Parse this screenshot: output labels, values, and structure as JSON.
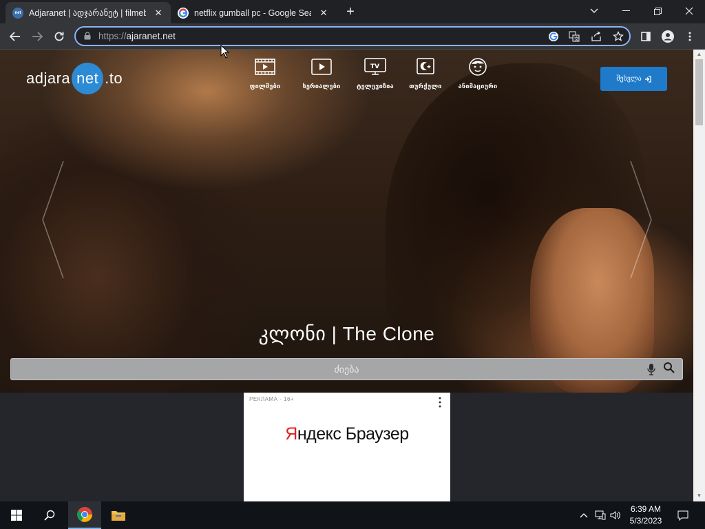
{
  "browser": {
    "tabs": [
      {
        "title": "Adjaranet | ადჯარანეტ | filmebi",
        "favicon": "net",
        "active": true
      },
      {
        "title": "netflix gumball pc - Google Search",
        "favicon": "google",
        "active": false
      }
    ],
    "url_scheme": "https://",
    "url_host": "ajaranet.net"
  },
  "site": {
    "logo": {
      "left": "adjara",
      "circle": "net",
      "right": ".to"
    },
    "menu": [
      {
        "label": "ფილმები",
        "icon": "film-icon"
      },
      {
        "label": "სერიალები",
        "icon": "play-icon"
      },
      {
        "label": "ტელევიზია",
        "icon": "tv-icon"
      },
      {
        "label": "თურქული",
        "icon": "turkish-icon"
      },
      {
        "label": "ანიმაციური",
        "icon": "cartoon-face-icon"
      }
    ],
    "enter_label": "შესვლა",
    "hero_title": "კლონი | The Clone",
    "search_placeholder": "ძიება"
  },
  "ad": {
    "tag": "РЕКЛАМА · 16+",
    "brand_red": "Я",
    "brand_rest": "ндекс Браузер"
  },
  "taskbar": {
    "time": "6:39 AM",
    "date": "5/3/2023"
  },
  "colors": {
    "accent": "#1f7ac9",
    "logo_circle": "#2d8bd6",
    "omnibox_focus": "#8ab4f8"
  }
}
